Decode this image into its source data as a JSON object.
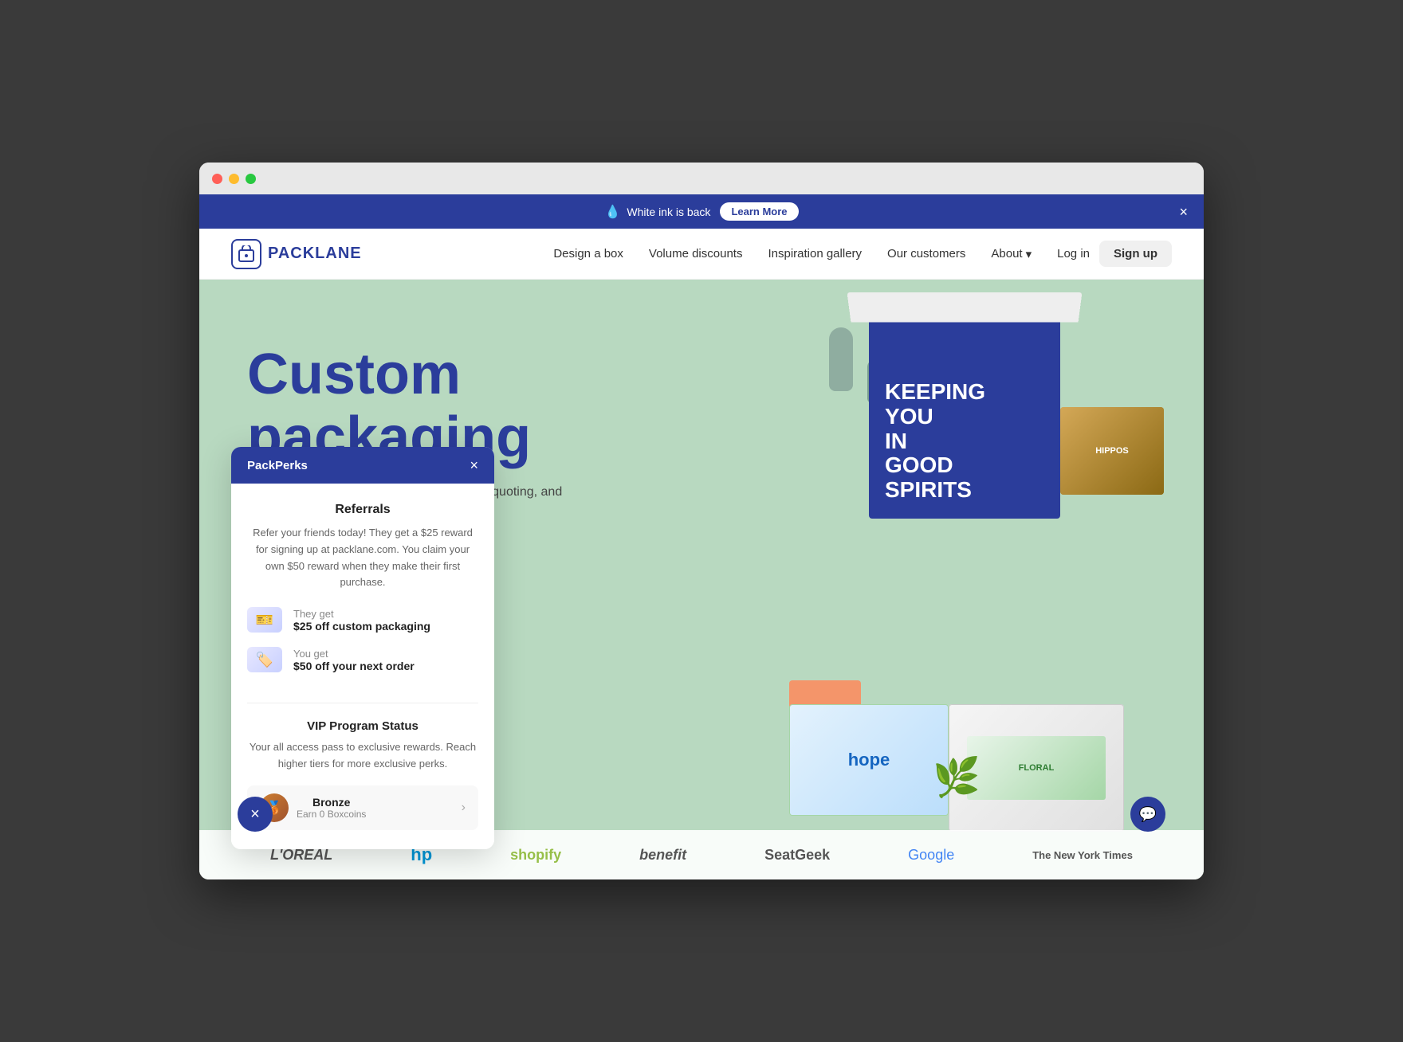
{
  "browser": {
    "traffic_lights": [
      "red",
      "yellow",
      "green"
    ]
  },
  "announcement": {
    "icon": "💧",
    "text": "White ink is back",
    "cta_label": "Learn More",
    "close_label": "×"
  },
  "navbar": {
    "logo_text": "PACKLANE",
    "nav_links": [
      {
        "label": "Design a box",
        "id": "design-a-box"
      },
      {
        "label": "Volume discounts",
        "id": "volume-discounts"
      },
      {
        "label": "Inspiration gallery",
        "id": "inspiration-gallery"
      },
      {
        "label": "Our customers",
        "id": "our-customers"
      },
      {
        "label": "About",
        "id": "about",
        "has_dropdown": true
      }
    ],
    "login_label": "Log in",
    "signup_label": "Sign up"
  },
  "hero": {
    "heading_line1": "Custom",
    "heading_line2": "packaging",
    "subtext": "Turn your brand into the total package with quoting, and fast turnarounds.",
    "box_text": "KEEPING\nyou\nIN\nGOOD\nSPIRITS"
  },
  "brands": [
    "L'ORÉAL",
    "hp",
    "shopify",
    "benefit",
    "SeatGeek",
    "Google",
    "The New York Times"
  ],
  "packperks": {
    "title": "PackPerks",
    "close_label": "×",
    "referrals": {
      "section_title": "Referrals",
      "description": "Refer your friends today! They get a $25 reward for signing up at packlane.com. You claim your own $50 reward when they make their first purchase.",
      "they_get_label": "They get",
      "they_get_value": "$25 off custom packaging",
      "you_get_label": "You get",
      "you_get_value": "$50 off your next order"
    },
    "vip": {
      "section_title": "VIP Program Status",
      "description": "Your all access pass to exclusive rewards. Reach higher tiers for more exclusive perks.",
      "tier_label": "Bronze",
      "tier_sub": "Earn 0 Boxcoins"
    }
  },
  "close_fab_label": "×",
  "chat_fab_icon": "💬"
}
